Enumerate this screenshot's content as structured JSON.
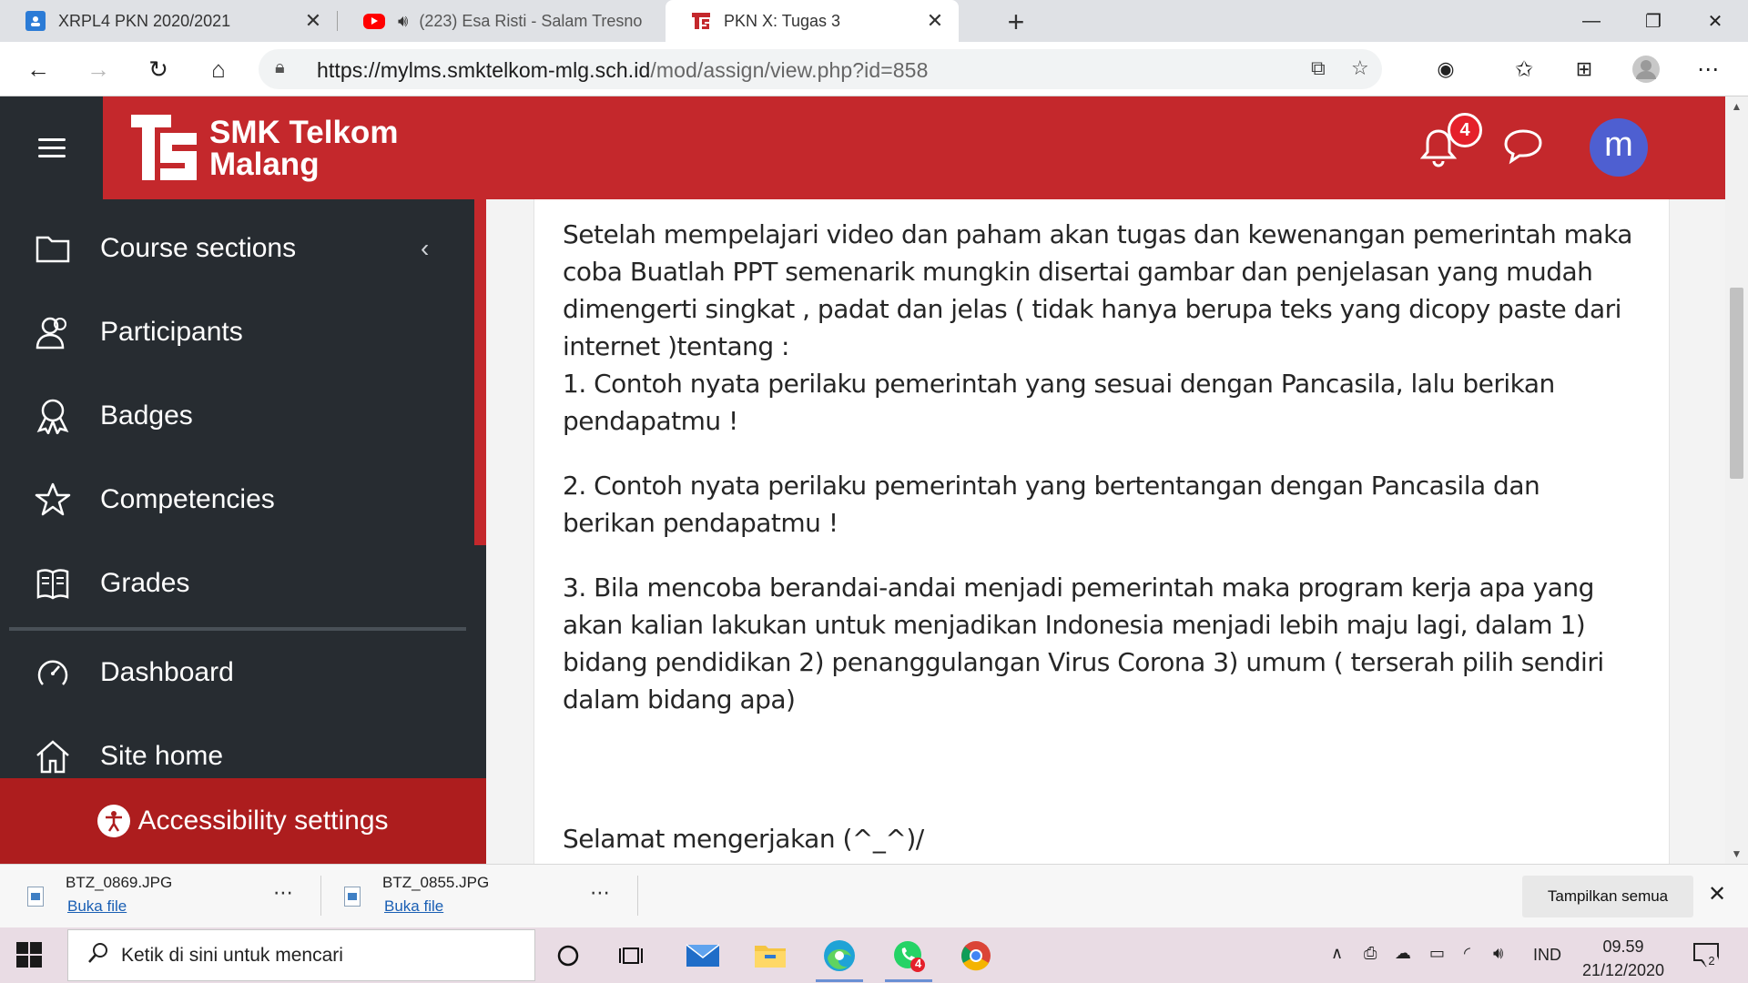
{
  "browser": {
    "tabs": [
      {
        "title": "XRPL4 PKN 2020/2021",
        "icon": "user-icon"
      },
      {
        "title": "(223) Esa Risti - Salam Tresno",
        "icon": "youtube-icon",
        "audio": "speaker-icon"
      },
      {
        "title": "PKN X: Tugas 3",
        "icon": "telkom-icon"
      }
    ],
    "url_host": "https://mylms.smktelkom-mlg.sch.id",
    "url_path": "/mod/assign/view.php?id=858"
  },
  "header": {
    "logo_line1": "SMK Telkom",
    "logo_line2": "Malang",
    "notification_count": "4",
    "avatar_letter": "m",
    "brand_color": "#c4282c"
  },
  "sidebar": {
    "items": [
      {
        "label": "Course sections",
        "icon": "folder-icon"
      },
      {
        "label": "Participants",
        "icon": "participants-icon"
      },
      {
        "label": "Badges",
        "icon": "badge-icon"
      },
      {
        "label": "Competencies",
        "icon": "star-icon"
      },
      {
        "label": "Grades",
        "icon": "grades-book-icon"
      },
      {
        "label": "Dashboard",
        "icon": "dashboard-icon"
      },
      {
        "label": "Site home",
        "icon": "home-icon"
      }
    ],
    "accessibility_label": "Accessibility settings"
  },
  "content": {
    "intro": "Setelah mempelajari video dan paham akan tugas dan kewenangan  pemerintah maka coba Buatlah PPT semenarik mungkin disertai gambar dan penjelasan yang mudah dimengerti singkat , padat dan jelas ( tidak hanya berupa teks yang dicopy paste dari internet )tentang :",
    "point1": "1.  Contoh nyata perilaku pemerintah yang sesuai dengan Pancasila, lalu berikan pendapatmu !",
    "point2": "2. Contoh nyata perilaku pemerintah yang bertentangan dengan Pancasila dan berikan pendapatmu !",
    "point3": "3. Bila mencoba berandai-andai menjadi pemerintah maka program kerja apa yang akan kalian lakukan untuk menjadikan Indonesia menjadi lebih maju lagi, dalam 1) bidang pendidikan 2) penanggulangan Virus Corona 3) umum ( terserah pilih sendiri dalam bidang apa)",
    "closing": "Selamat mengerjakan (^_^)/"
  },
  "downloads": {
    "items": [
      {
        "name": "BTZ_0869.JPG",
        "action": "Buka file"
      },
      {
        "name": "BTZ_0855.JPG",
        "action": "Buka file"
      }
    ],
    "show_all": "Tampilkan semua"
  },
  "taskbar": {
    "search_placeholder": "Ketik di sini untuk mencari",
    "whatsapp_badge": "4",
    "language": "IND",
    "time": "09.59",
    "date": "21/12/2020",
    "notification_count": "2"
  }
}
